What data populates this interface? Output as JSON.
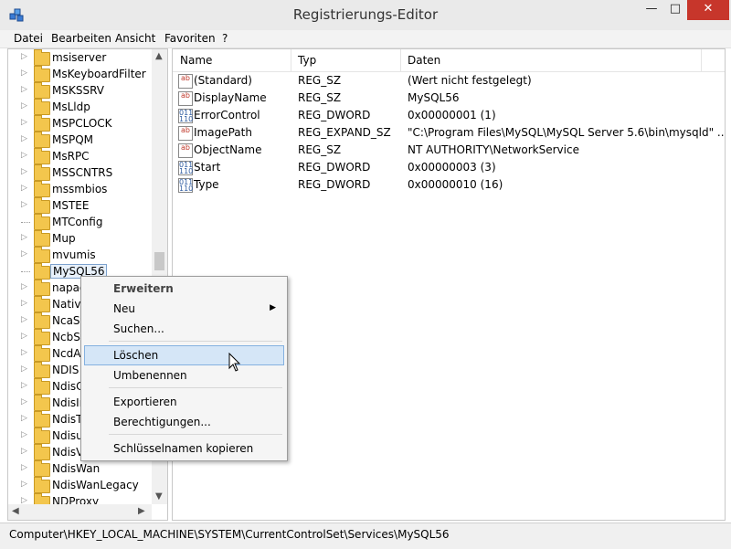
{
  "window": {
    "title": "Registrierungs-Editor",
    "close_label": "✕",
    "maximize_label": "□",
    "minimize_label": "—"
  },
  "menu": [
    "Datei",
    "Bearbeiten",
    "Ansicht",
    "Favoriten",
    "?"
  ],
  "tree": {
    "items": [
      "msiserver",
      "MsKeyboardFilter",
      "MSKSSRV",
      "MsLldp",
      "MSPCLOCK",
      "MSPQM",
      "MsRPC",
      "MSSCNTRS",
      "mssmbios",
      "MSTEE",
      "MTConfig",
      "Mup",
      "mvumis",
      "MySQL56",
      "napagent",
      "NativeWifiP",
      "NcaSvc",
      "NcbService",
      "NcdAutoSetup",
      "NDIS",
      "NdisCap",
      "NdisImPlatform",
      "NdisTapi",
      "Ndisuio",
      "NdisVirtualBus",
      "NdisWan",
      "NdisWanLegacy",
      "NDProxy"
    ],
    "selected": "MySQL56"
  },
  "list": {
    "columns": [
      "Name",
      "Typ",
      "Daten"
    ],
    "rows": [
      {
        "icon": "string-value-icon",
        "name": "(Standard)",
        "type": "REG_SZ",
        "data": "(Wert nicht festgelegt)"
      },
      {
        "icon": "string-value-icon",
        "name": "DisplayName",
        "type": "REG_SZ",
        "data": "MySQL56"
      },
      {
        "icon": "dword-value-icon",
        "name": "ErrorControl",
        "type": "REG_DWORD",
        "data": "0x00000001 (1)"
      },
      {
        "icon": "string-value-icon",
        "name": "ImagePath",
        "type": "REG_EXPAND_SZ",
        "data": "\"C:\\Program Files\\MySQL\\MySQL Server 5.6\\bin\\mysqld\" ..."
      },
      {
        "icon": "string-value-icon",
        "name": "ObjectName",
        "type": "REG_SZ",
        "data": "NT AUTHORITY\\NetworkService"
      },
      {
        "icon": "dword-value-icon",
        "name": "Start",
        "type": "REG_DWORD",
        "data": "0x00000003 (3)"
      },
      {
        "icon": "dword-value-icon",
        "name": "Type",
        "type": "REG_DWORD",
        "data": "0x00000010 (16)"
      }
    ]
  },
  "context_menu": {
    "items": [
      {
        "label": "Erweitern",
        "bold": true
      },
      {
        "label": "Neu",
        "submenu": true
      },
      {
        "label": "Suchen..."
      },
      {
        "label": "Löschen",
        "highlighted": true
      },
      {
        "label": "Umbenennen"
      },
      {
        "label": "Exportieren"
      },
      {
        "label": "Berechtigungen..."
      },
      {
        "label": "Schlüsselnamen kopieren"
      }
    ]
  },
  "status": {
    "path": "Computer\\HKEY_LOCAL_MACHINE\\SYSTEM\\CurrentControlSet\\Services\\MySQL56"
  },
  "colors": {
    "close_button": "#c7362b",
    "selection_highlight": "#d5e6f7",
    "folder": "#f3c64d"
  }
}
